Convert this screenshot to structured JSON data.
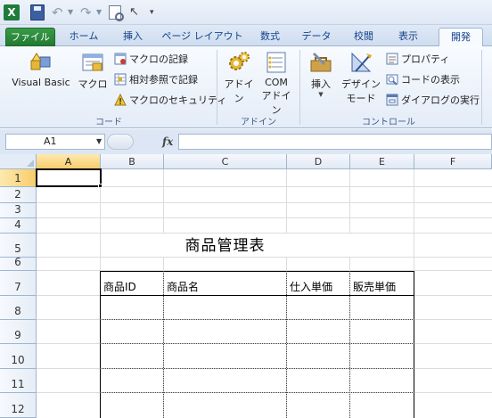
{
  "qat": {
    "app_icon": "excel-icon",
    "save_icon": "save-icon",
    "undo_icon": "undo-icon",
    "redo_icon": "redo-icon",
    "preview_icon": "print-preview-icon",
    "pointer_icon": "select-pointer-icon",
    "customize_icon": "customize-qat-icon"
  },
  "tabs": [
    "ファイル",
    "ホーム",
    "挿入",
    "ページ レイアウト",
    "数式",
    "データ",
    "校閲",
    "表示",
    "開発"
  ],
  "active_tab": "開発",
  "ribbon": {
    "code_group": {
      "label": "コード",
      "visual_basic": "Visual Basic",
      "macro": "マクロ",
      "record_macro": "マクロの記録",
      "relative_ref": "相対参照で記録",
      "macro_security": "マクロのセキュリティ"
    },
    "addin_group": {
      "label": "アドイン",
      "addin": "アドイン",
      "com_addin_line1": "COM",
      "com_addin_line2": "アドイン"
    },
    "controls_group": {
      "label": "コントロール",
      "insert": "挿入",
      "design_mode_line1": "デザイン",
      "design_mode_line2": "モード",
      "properties": "プロパティ",
      "view_code": "コードの表示",
      "run_dialog": "ダイアログの実行"
    }
  },
  "formula_bar": {
    "name_box": "A1",
    "fx": "fx",
    "formula": ""
  },
  "columns": [
    "A",
    "B",
    "C",
    "D",
    "E",
    "F"
  ],
  "rows": [
    "1",
    "2",
    "3",
    "4",
    "5",
    "6",
    "7",
    "8",
    "9",
    "10",
    "11",
    "12"
  ],
  "selected_cell": {
    "column": "A",
    "row": "1"
  },
  "sheet": {
    "title": "商品管理表",
    "table_headers": [
      "商品ID",
      "商品名",
      "仕入単価",
      "販売単価"
    ]
  },
  "colors": {
    "file_tab": "#237a32",
    "ribbon_text": "#15428b",
    "header_selected": "#f8cd6c",
    "gridline": "#dadcdd"
  }
}
